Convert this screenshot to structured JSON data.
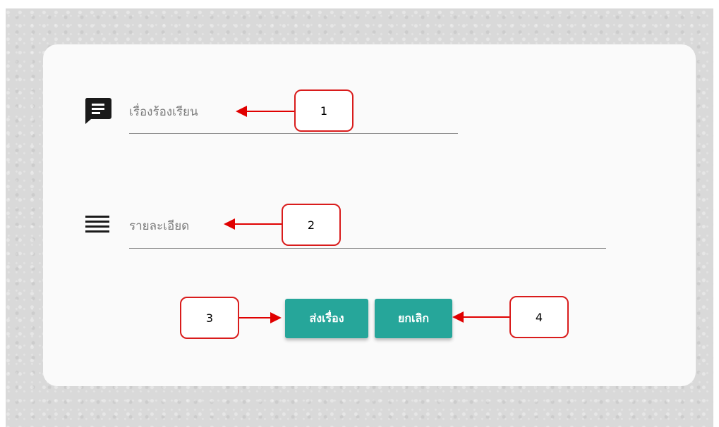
{
  "form": {
    "subject_placeholder": "เรื่องร้องเรียน",
    "detail_placeholder": "รายละเอียด",
    "submit_label": "ส่งเรื่อง",
    "cancel_label": "ยกเลิก"
  },
  "icons": {
    "subject": "chat-icon",
    "detail": "menu-icon"
  },
  "annotations": [
    "1",
    "2",
    "3",
    "4"
  ],
  "colors": {
    "button": "#26a69a",
    "annotation": "#e00000",
    "background": "#d9d9d9",
    "card": "#fafafa"
  }
}
